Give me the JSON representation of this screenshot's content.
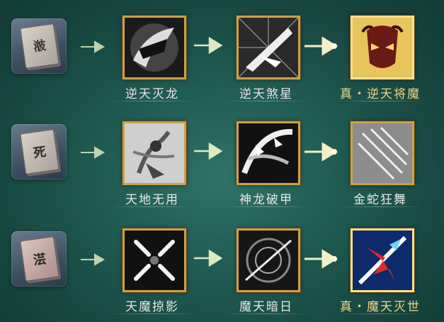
{
  "rows": [
    {
      "book_glyph": "𣷭",
      "book_icon": "secret-manual-book-icon",
      "skills": [
        {
          "name": "逆天灭龙",
          "icon": "dragon-fist-icon",
          "gold": false
        },
        {
          "name": "逆天煞星",
          "icon": "star-slash-icon",
          "gold": false
        },
        {
          "name": "真・逆天将魔",
          "icon": "demon-mask-icon",
          "gold": true
        }
      ]
    },
    {
      "book_glyph": "死",
      "book_icon": "secret-manual-book-icon",
      "skills": [
        {
          "name": "天地无用",
          "icon": "warrior-dance-icon",
          "gold": false
        },
        {
          "name": "神龙破甲",
          "icon": "dragon-armor-break-icon",
          "gold": false
        },
        {
          "name": "金蛇狂舞",
          "icon": "golden-serpent-icon",
          "gold": false
        }
      ]
    },
    {
      "book_glyph": "𣶽",
      "book_icon": "secret-manual-book-icon",
      "skills": [
        {
          "name": "天魔掠影",
          "icon": "shadow-strike-icon",
          "gold": false
        },
        {
          "name": "魔天暗日",
          "icon": "dark-sun-icon",
          "gold": false
        },
        {
          "name": "真・魔天灭世",
          "icon": "world-destroy-icon",
          "gold": true
        }
      ]
    }
  ],
  "colors": {
    "background": "#1f5a52",
    "frame_gold": "#c9a24a",
    "label_normal": "#e8e6e1",
    "label_gold": "#f0d584",
    "arrow": "#dfe8c0"
  }
}
